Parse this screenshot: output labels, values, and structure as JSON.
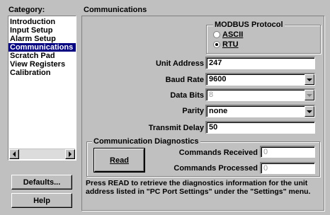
{
  "category_header": "Category:",
  "categories": [
    {
      "label": "Introduction",
      "selected": false
    },
    {
      "label": "Input Setup",
      "selected": false
    },
    {
      "label": "Alarm Setup",
      "selected": false
    },
    {
      "label": "Communications",
      "selected": true
    },
    {
      "label": "Scratch Pad",
      "selected": false
    },
    {
      "label": "View Registers",
      "selected": false
    },
    {
      "label": "Calibration",
      "selected": false
    }
  ],
  "section_title": "Communications",
  "modbus": {
    "legend": "MODBUS Protocol",
    "ascii_label": "ASCII",
    "rtu_label": "RTU",
    "selected": "RTU"
  },
  "fields": {
    "unit_address_label": "Unit Address",
    "unit_address_value": "247",
    "baud_rate_label": "Baud Rate",
    "baud_rate_value": "9600",
    "data_bits_label": "Data Bits",
    "data_bits_value": "8",
    "parity_label": "Parity",
    "parity_value": "none",
    "transmit_delay_label": "Transmit Delay",
    "transmit_delay_value": "50"
  },
  "diagnostics": {
    "legend": "Communication Diagnostics",
    "read_label": "Read",
    "commands_received_label": "Commands Received",
    "commands_received_value": "0",
    "commands_processed_label": "Commands Processed",
    "commands_processed_value": "0",
    "note": "Press READ to retrieve the diagnostics information for the unit address listed in \"PC Port Settings\" under the \"Settings\" menu."
  },
  "buttons": {
    "defaults": "Defaults...",
    "help": "Help"
  },
  "icons": {
    "scroll_left": "arrow-left-icon",
    "scroll_right": "arrow-right-icon",
    "dropdown": "chevron-down-icon"
  }
}
